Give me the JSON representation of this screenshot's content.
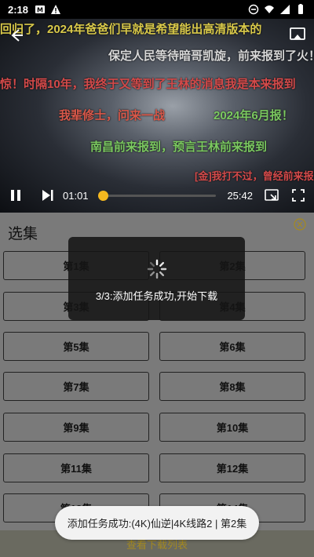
{
  "status_bar": {
    "time": "2:18",
    "icons_left": [
      "notification-m-icon",
      "alert-icon"
    ],
    "icons_right": [
      "dnd-icon",
      "wifi-icon",
      "signal-icon",
      "battery-icon"
    ]
  },
  "video": {
    "current_time": "01:01",
    "total_time": "25:42",
    "progress_fraction": 0.04,
    "danmaku": [
      "回归了，2024年爸爸们早就是希望能出高清版本的",
      "保定人民等待暗哥凯旋，前来报到了火！",
      "惊！时隔10年，我终于又等到了王林的消息我是本来报到",
      "我辈修士，问来一战",
      "2024年6月报！",
      "南昌前来报到，预言王林前来报到",
      "[金]我打不过，曾经前来报道"
    ]
  },
  "panel": {
    "title": "选集",
    "episodes": [
      "第1集",
      "第2集",
      "第3集",
      "第4集",
      "第5集",
      "第6集",
      "第7集",
      "第8集",
      "第9集",
      "第10集",
      "第11集",
      "第12集",
      "第13集",
      "第14集"
    ],
    "footer_link": "查看下载列表"
  },
  "loading_dialog": {
    "message": "3/3:添加任务成功,开始下载"
  },
  "toast": {
    "message": "添加任务成功:(4K)仙逆|4K线路2 | 第2集"
  },
  "colors": {
    "accent": "#f5b81f",
    "panel_bg": "#7a7a7a",
    "dialog_bg": "#141414"
  }
}
